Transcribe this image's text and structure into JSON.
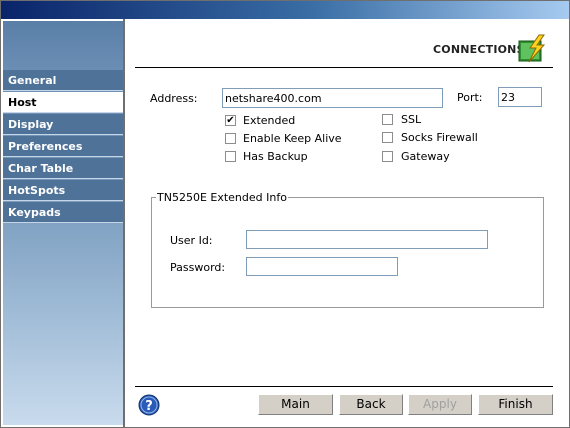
{
  "window": {
    "title": ""
  },
  "sidebar": {
    "items": [
      {
        "label": "General",
        "active": false
      },
      {
        "label": "Host",
        "active": true
      },
      {
        "label": "Display",
        "active": false
      },
      {
        "label": "Preferences",
        "active": false
      },
      {
        "label": "Char Table",
        "active": false
      },
      {
        "label": "HotSpots",
        "active": false
      },
      {
        "label": "Keypads",
        "active": false
      }
    ]
  },
  "header": {
    "title": "CONNECTIONS",
    "icon": "connection-lightning-icon"
  },
  "form": {
    "address_label": "Address:",
    "address_value": "netshare400.com",
    "port_label": "Port:",
    "port_value": "23",
    "checkboxes": {
      "extended": {
        "label": "Extended",
        "checked": true
      },
      "keep_alive": {
        "label": "Enable Keep Alive",
        "checked": false
      },
      "has_backup": {
        "label": "Has Backup",
        "checked": false
      },
      "ssl": {
        "label": "SSL",
        "checked": false
      },
      "socks_firewall": {
        "label": "Socks Firewall",
        "checked": false
      },
      "gateway": {
        "label": "Gateway",
        "checked": false
      }
    },
    "group": {
      "title": "TN5250E Extended Info",
      "user_id_label": "User Id:",
      "user_id_value": "",
      "password_label": "Password:",
      "password_value": ""
    }
  },
  "footer": {
    "help_icon": "help-icon",
    "buttons": {
      "main": {
        "label": "Main",
        "enabled": true
      },
      "back": {
        "label": "Back",
        "enabled": true
      },
      "apply": {
        "label": "Apply",
        "enabled": false
      },
      "finish": {
        "label": "Finish",
        "enabled": true
      }
    }
  },
  "colors": {
    "sidebar_item": "#4f7298",
    "accent": "#0a246a",
    "checkbox_border": "#8d8d8d"
  }
}
